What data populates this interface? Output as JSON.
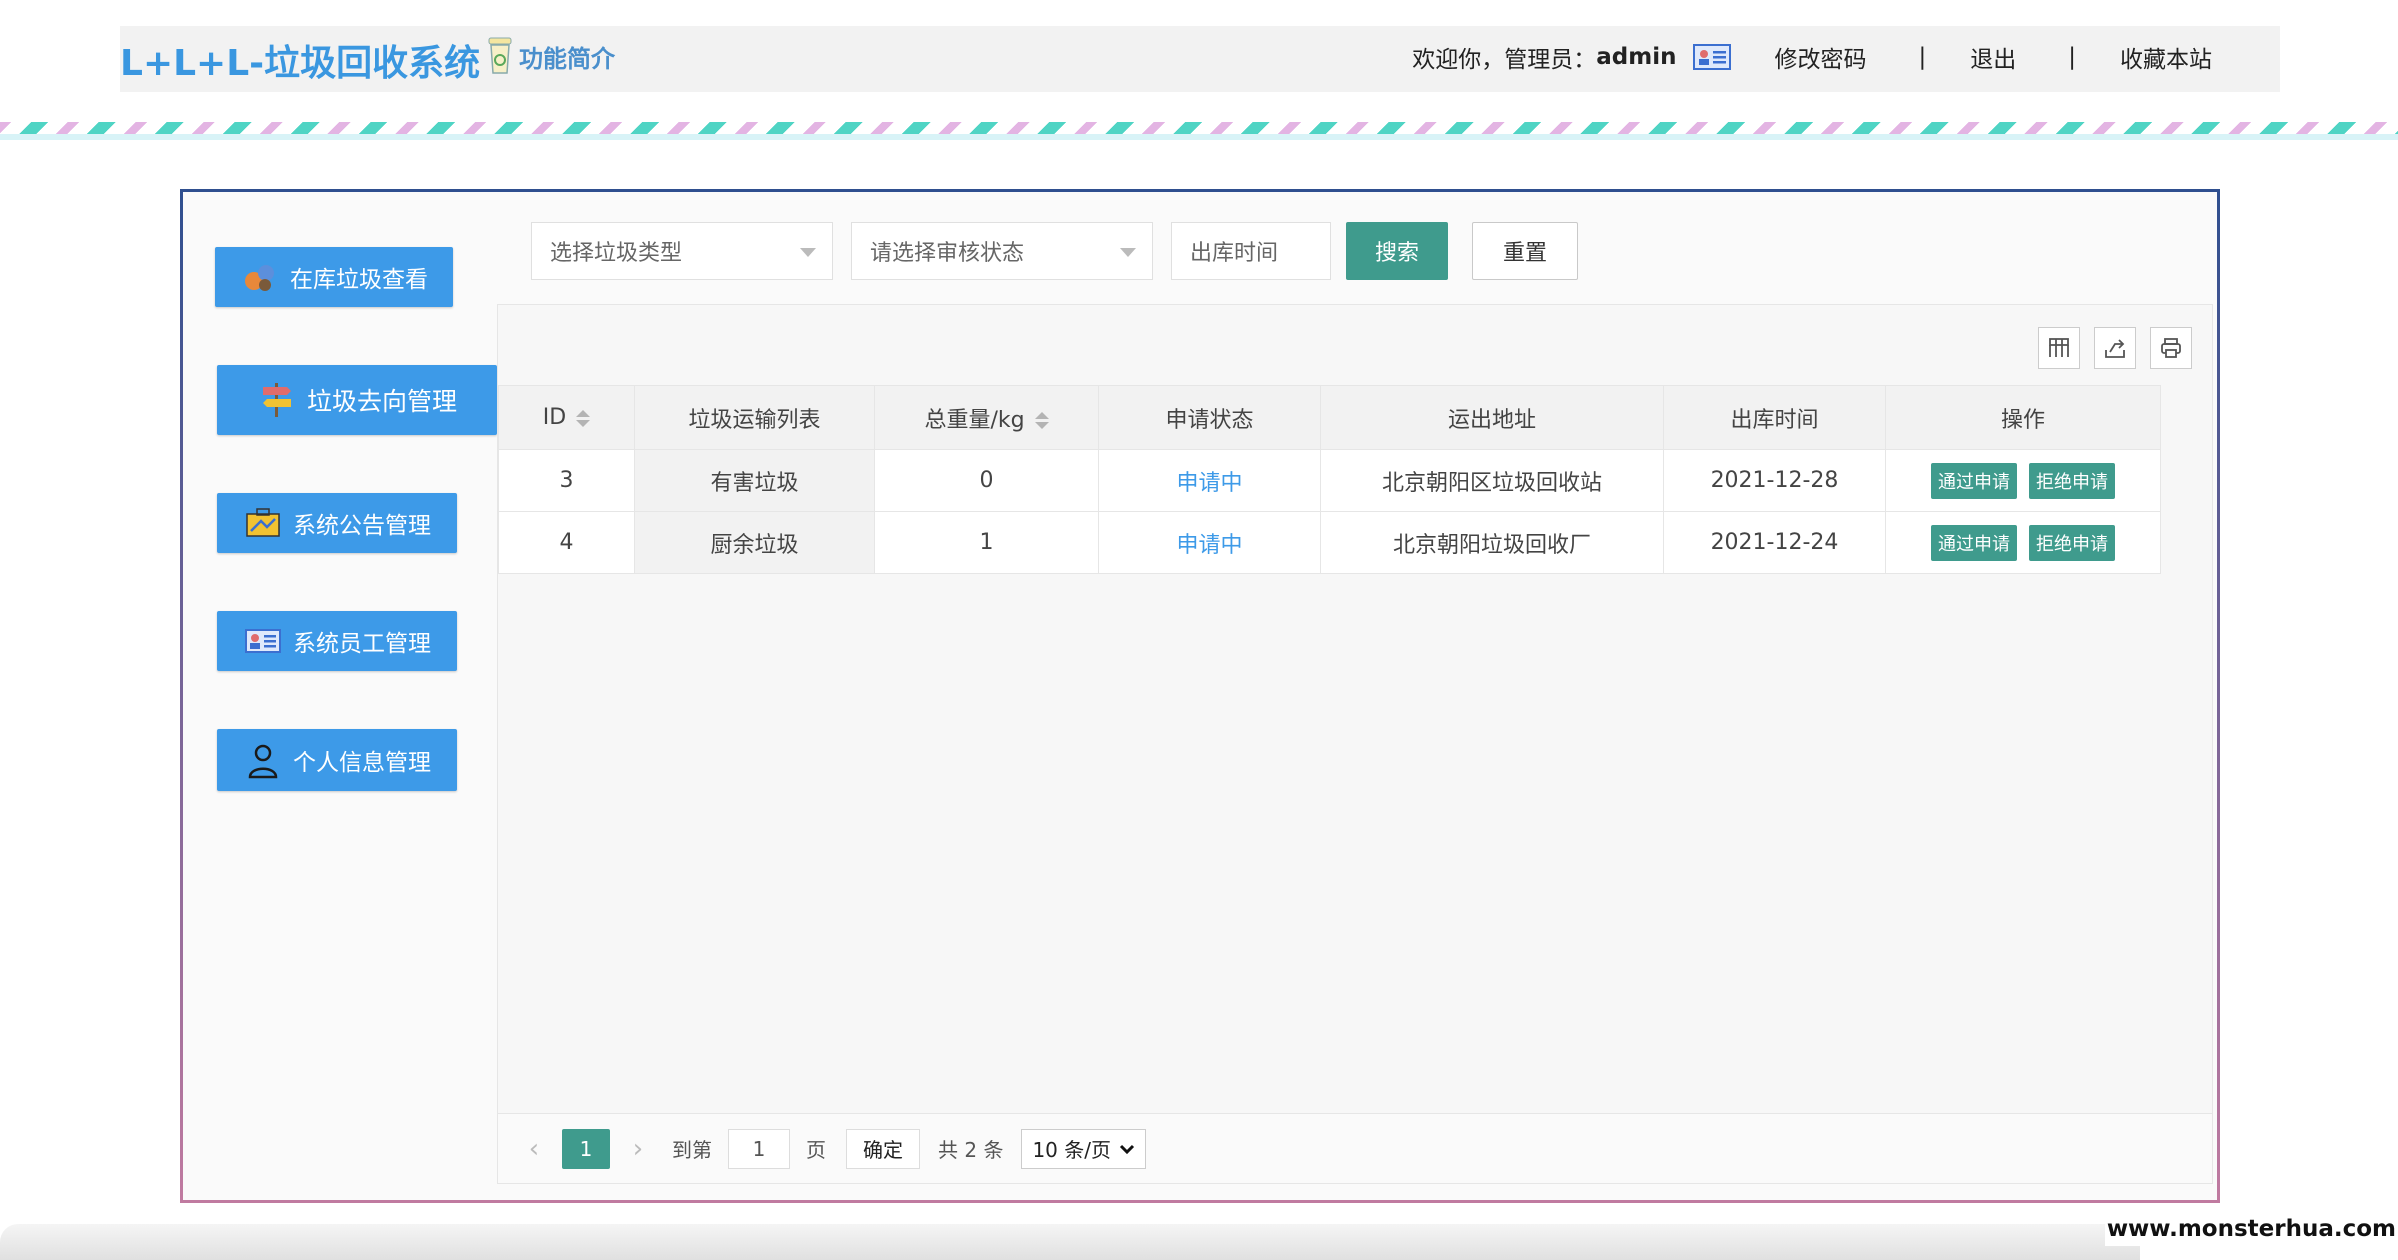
{
  "header": {
    "brand": "L+L+L-垃圾回收系统",
    "intro_label": "功能简介",
    "welcome_prefix": "欢迎你，管理员：",
    "admin_name": "admin",
    "change_password": "修改密码",
    "separator": "|",
    "logout": "退出",
    "bookmark": "收藏本站"
  },
  "sidebar": {
    "items": [
      {
        "label": "在库垃圾查看",
        "icon": "recycle-icon"
      },
      {
        "label": "垃圾去向管理",
        "icon": "signpost-icon"
      },
      {
        "label": "系统公告管理",
        "icon": "briefcase-icon"
      },
      {
        "label": "系统员工管理",
        "icon": "id-card-icon"
      },
      {
        "label": "个人信息管理",
        "icon": "user-icon"
      }
    ]
  },
  "toolbar": {
    "type_placeholder": "选择垃圾类型",
    "status_placeholder": "请选择审核状态",
    "date_placeholder": "出库时间",
    "search_label": "搜索",
    "reset_label": "重置"
  },
  "table": {
    "columns": [
      "ID",
      "垃圾运输列表",
      "总重量/kg",
      "申请状态",
      "运出地址",
      "出库时间",
      "操作"
    ],
    "rows": [
      {
        "id": "3",
        "type": "有害垃圾",
        "weight": "0",
        "status": "申请中",
        "address": "北京朝阳区垃圾回收站",
        "date": "2021-12-28"
      },
      {
        "id": "4",
        "type": "厨余垃圾",
        "weight": "1",
        "status": "申请中",
        "address": "北京朝阳垃圾回收厂",
        "date": "2021-12-24"
      }
    ],
    "approve_label": "通过申请",
    "reject_label": "拒绝申请"
  },
  "pager": {
    "current": "1",
    "goto_label": "到第",
    "goto_value": "1",
    "page_unit": "页",
    "confirm": "确定",
    "total": "共 2 条",
    "page_size": "10 条/页"
  },
  "watermark": "www.monsterhua.com",
  "colors": {
    "primary_blue": "#3d9ae8",
    "teal": "#3f9b8d"
  }
}
